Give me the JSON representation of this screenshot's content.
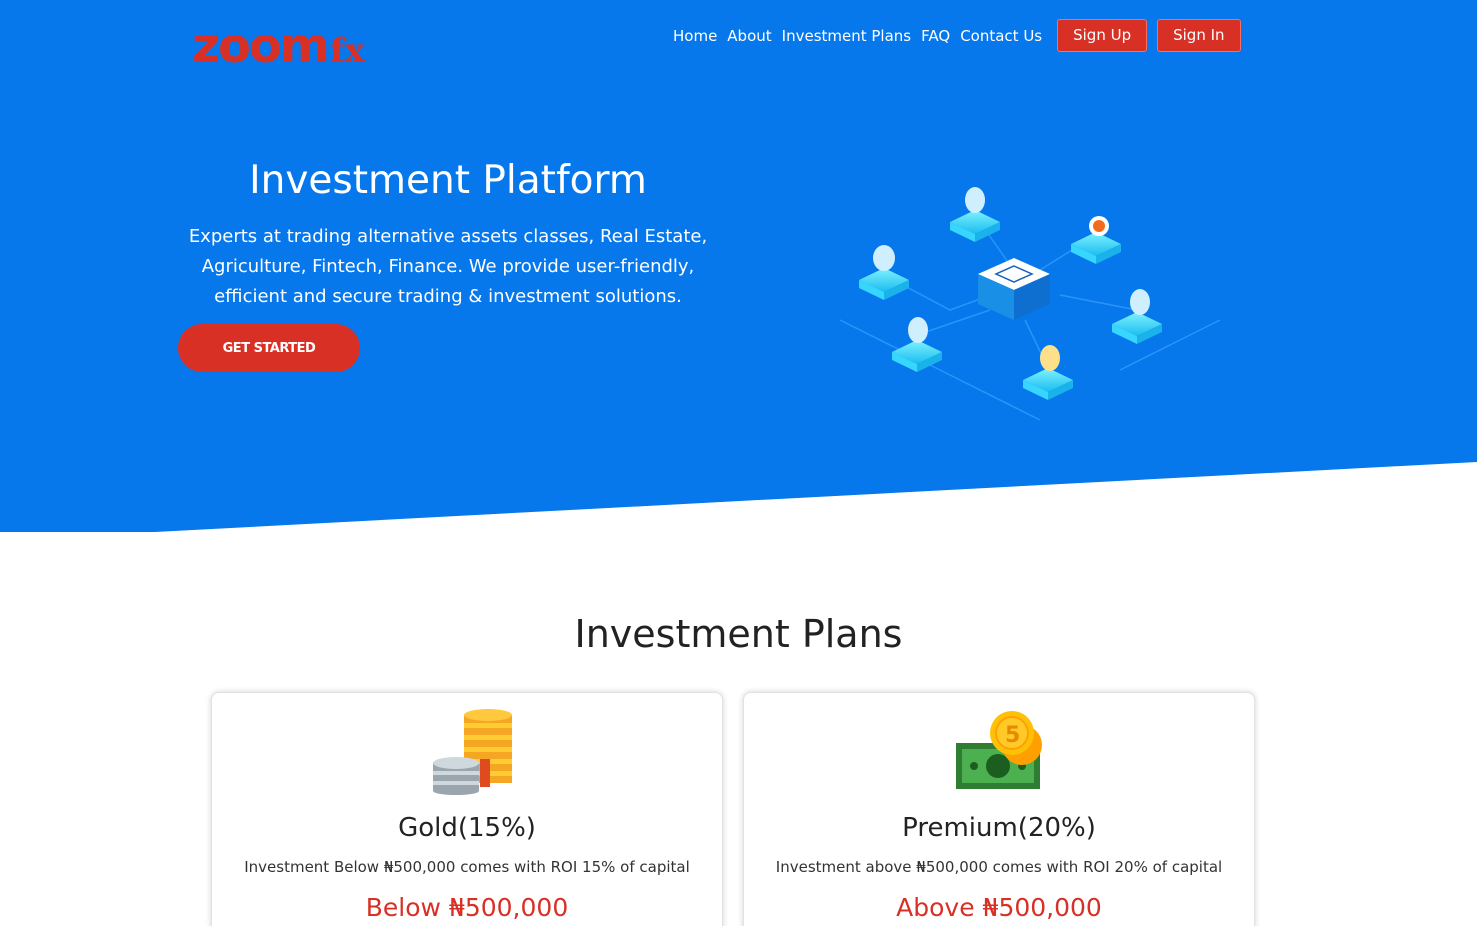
{
  "brand": {
    "logo_main": "zoom",
    "logo_suffix": "fx",
    "color_primary": "#0678ec",
    "color_accent": "#d93025"
  },
  "nav": {
    "links": [
      "Home",
      "About",
      "Investment Plans",
      "FAQ",
      "Contact Us"
    ],
    "signup_label": "Sign Up",
    "signin_label": "Sign In"
  },
  "hero": {
    "title": "Investment Platform",
    "description": "Experts at trading alternative assets classes, Real Estate, Agriculture, Fintech, Finance. We provide user-friendly, efficient and secure trading & investment solutions.",
    "cta_label": "GET STARTED",
    "illustration_icon": "crypto-network-illustration"
  },
  "plans": {
    "title": "Investment Plans",
    "items": [
      {
        "icon": "gold-coins-icon",
        "name": "Gold(15%)",
        "description": "Investment Below ₦500,000 comes with ROI 15% of capital",
        "price": "Below ₦500,000"
      },
      {
        "icon": "cash-coins-icon",
        "name": "Premium(20%)",
        "description": "Investment above ₦500,000 comes with ROI 20% of capital",
        "price": "Above ₦500,000"
      }
    ]
  }
}
